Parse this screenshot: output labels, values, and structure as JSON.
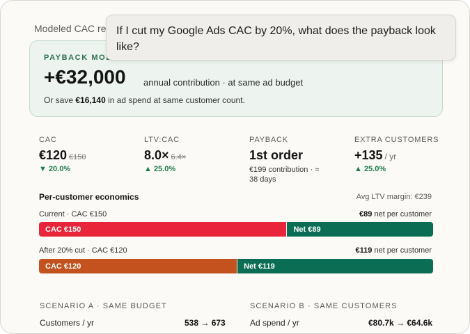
{
  "header": {
    "title": "Modeled CAC re"
  },
  "prompt": {
    "text": "If I cut my Google Ads CAC by 20%, what does the payback look like?"
  },
  "summary": {
    "label": "PAYBACK MODE",
    "amount": "+€32,000",
    "subtitle": "annual contribution · at same ad budget",
    "note_prefix": "Or save ",
    "note_bold": "€16,140",
    "note_suffix": " in ad spend at same customer count."
  },
  "metrics": [
    {
      "label": "CAC",
      "value": "€120",
      "old": "€150",
      "change": "▼ 20.0%"
    },
    {
      "label": "LTV:CAC",
      "value": "8.0×",
      "old": "6.4×",
      "change": "▲ 25.0%"
    },
    {
      "label": "PAYBACK",
      "value": "1st order",
      "detail": "€199 contribution · ≈ 38 days"
    },
    {
      "label": "EXTRA CUSTOMERS",
      "value": "+135",
      "unit": "/ yr",
      "change": "▲ 25.0%"
    }
  ],
  "economics": {
    "title": "Per-customer economics",
    "margin_label": "Avg LTV margin: €239",
    "bars": [
      {
        "label": "Current · CAC €150",
        "net_bold": "€89",
        "net_suffix": " net per customer",
        "cost_label": "CAC €150",
        "net_label": "Net €89",
        "cost_fraction": 0.628,
        "color": "#e8253a"
      },
      {
        "label": "After 20% cut · CAC €120",
        "net_bold": "€119",
        "net_suffix": " net per customer",
        "cost_label": "CAC €120",
        "net_label": "Net €119",
        "cost_fraction": 0.502,
        "color": "#c4521f"
      }
    ]
  },
  "scenarios": {
    "a": {
      "title": "SCENARIO A · SAME BUDGET",
      "row_label": "Customers / yr",
      "row_value": "538 → 673"
    },
    "b": {
      "title": "SCENARIO B · SAME CUSTOMERS",
      "row_label": "Ad spend / yr",
      "row_value": "€80.7k → €64.6k"
    }
  }
}
